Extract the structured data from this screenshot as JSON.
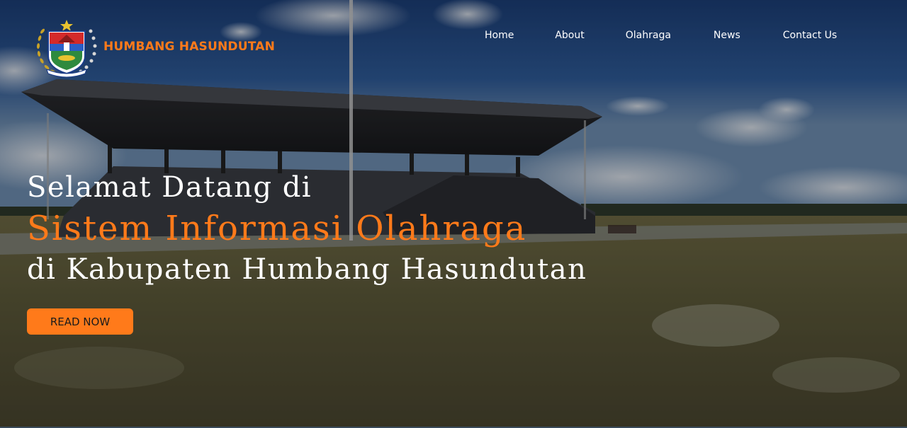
{
  "brand": {
    "name": "HUMBANG HASUNDUTAN",
    "color": "#ff7a1a"
  },
  "nav": {
    "items": [
      {
        "label": "Home"
      },
      {
        "label": "About"
      },
      {
        "label": "Olahraga"
      },
      {
        "label": "News"
      },
      {
        "label": "Contact Us"
      }
    ]
  },
  "hero": {
    "line1": "Selamat Datang di",
    "line2": "Sistem Informasi Olahraga",
    "line3": "di Kabupaten Humbang Hasundutan",
    "cta_label": "READ NOW",
    "accent_color": "#ff7a1a",
    "background_scene": "stadium-grandstand-field-photo"
  },
  "icons": {
    "logo": "regency-emblem-logo"
  }
}
